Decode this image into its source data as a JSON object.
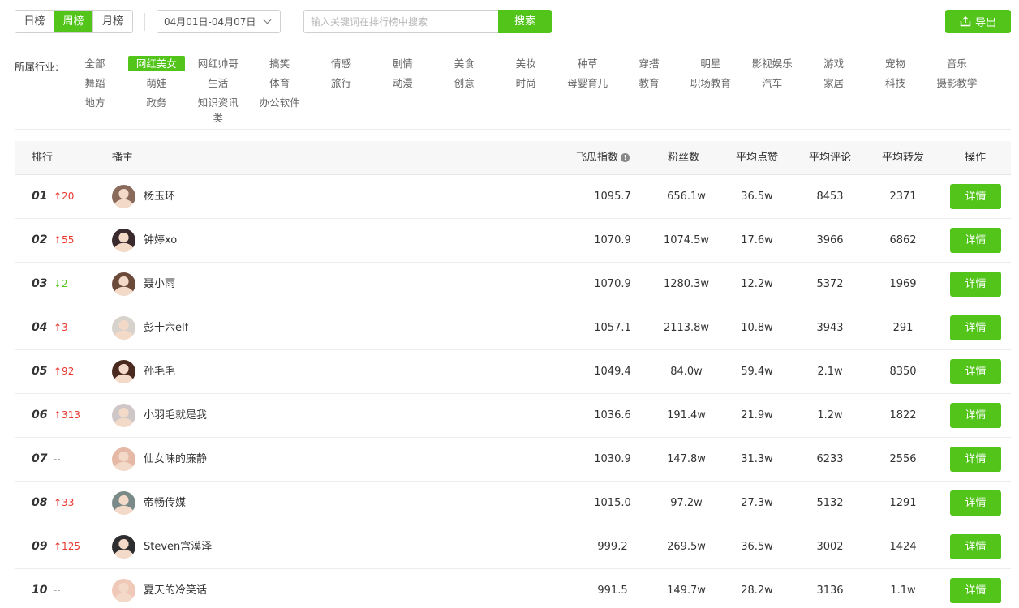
{
  "period_tabs": [
    {
      "label": "日榜",
      "active": false
    },
    {
      "label": "周榜",
      "active": true
    },
    {
      "label": "月榜",
      "active": false
    }
  ],
  "date_range": "04月01日-04月07日",
  "search": {
    "placeholder": "输入关键词在排行榜中搜索",
    "button": "搜索"
  },
  "export_label": "导出",
  "industry": {
    "label": "所属行业:",
    "items": [
      "全部",
      "网红美女",
      "网红帅哥",
      "搞笑",
      "情感",
      "剧情",
      "美食",
      "美妆",
      "种草",
      "穿搭",
      "明星",
      "影视娱乐",
      "游戏",
      "宠物",
      "音乐",
      "舞蹈",
      "萌娃",
      "生活",
      "体育",
      "旅行",
      "动漫",
      "创意",
      "时尚",
      "母婴育儿",
      "教育",
      "职场教育",
      "汽车",
      "家居",
      "科技",
      "摄影教学",
      "地方",
      "政务",
      "知识资讯类",
      "办公软件"
    ],
    "active": "网红美女"
  },
  "table": {
    "headers": {
      "rank": "排行",
      "host": "播主",
      "index": "飞瓜指数",
      "fans": "粉丝数",
      "likes": "平均点赞",
      "comments": "平均评论",
      "shares": "平均转发",
      "action": "操作"
    },
    "detail_label": "详情",
    "rows": [
      {
        "rank": "01",
        "change": "↑20",
        "dir": "up",
        "name": "杨玉环",
        "index": "1095.7",
        "fans": "656.1w",
        "likes": "36.5w",
        "comments": "8453",
        "shares": "2371"
      },
      {
        "rank": "02",
        "change": "↑55",
        "dir": "up",
        "name": "钟婷xo",
        "index": "1070.9",
        "fans": "1074.5w",
        "likes": "17.6w",
        "comments": "3966",
        "shares": "6862"
      },
      {
        "rank": "03",
        "change": "↓2",
        "dir": "down",
        "name": "聂小雨",
        "index": "1070.9",
        "fans": "1280.3w",
        "likes": "12.2w",
        "comments": "5372",
        "shares": "1969"
      },
      {
        "rank": "04",
        "change": "↑3",
        "dir": "up",
        "name": "彭十六elf",
        "index": "1057.1",
        "fans": "2113.8w",
        "likes": "10.8w",
        "comments": "3943",
        "shares": "291"
      },
      {
        "rank": "05",
        "change": "↑92",
        "dir": "up",
        "name": "孙毛毛",
        "index": "1049.4",
        "fans": "84.0w",
        "likes": "59.4w",
        "comments": "2.1w",
        "shares": "8350"
      },
      {
        "rank": "06",
        "change": "↑313",
        "dir": "up",
        "name": "小羽毛就是我",
        "index": "1036.6",
        "fans": "191.4w",
        "likes": "21.9w",
        "comments": "1.2w",
        "shares": "1822"
      },
      {
        "rank": "07",
        "change": "--",
        "dir": "flat",
        "name": "仙女味的廉静",
        "index": "1030.9",
        "fans": "147.8w",
        "likes": "31.3w",
        "comments": "6233",
        "shares": "2556"
      },
      {
        "rank": "08",
        "change": "↑33",
        "dir": "up",
        "name": "帝畅传媒",
        "index": "1015.0",
        "fans": "97.2w",
        "likes": "27.3w",
        "comments": "5132",
        "shares": "1291"
      },
      {
        "rank": "09",
        "change": "↑125",
        "dir": "up",
        "name": "Steven宫漠泽",
        "index": "999.2",
        "fans": "269.5w",
        "likes": "36.5w",
        "comments": "3002",
        "shares": "1424"
      },
      {
        "rank": "10",
        "change": "--",
        "dir": "flat",
        "name": "夏天的冷笑话",
        "index": "991.5",
        "fans": "149.7w",
        "likes": "28.2w",
        "comments": "3136",
        "shares": "1.1w"
      }
    ]
  },
  "colors": {
    "accent": "#52c41a",
    "up": "#e8382f",
    "down": "#52c41a",
    "avatar_palette": [
      "#8a6a5a",
      "#3a2a2e",
      "#6b4a3a",
      "#d8d2cc",
      "#4a2a1e",
      "#cfc6c8",
      "#e6b8a6",
      "#7a8a88",
      "#2e2e30",
      "#f0c8b8"
    ]
  }
}
